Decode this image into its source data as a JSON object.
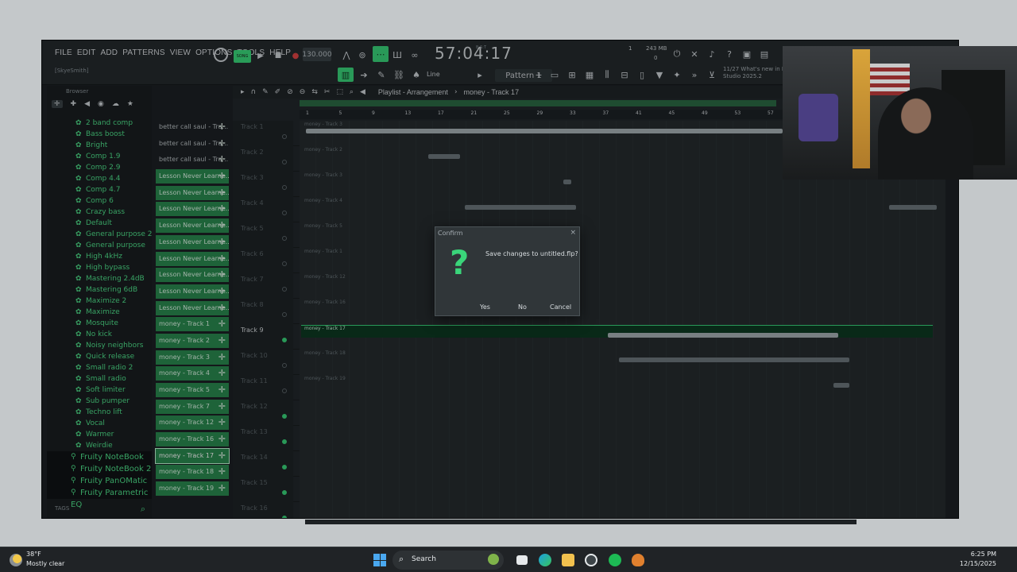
{
  "menu": [
    "FILE",
    "EDIT",
    "ADD",
    "PATTERNS",
    "VIEW",
    "OPTIONS",
    "TOOLS",
    "HELP"
  ],
  "user": "[SkyeSmith]",
  "transport": {
    "song_label": "SONG",
    "tempo": "130.000",
    "time": "57:04:17",
    "time_sub": "B:S:T"
  },
  "memory": {
    "mb": "243 MB",
    "zero": "0",
    "one": "1"
  },
  "pattern": {
    "label": "Pattern 1"
  },
  "line_mode": "Line",
  "news": "11/27  What's new in FL Studio 2025.2",
  "browser": {
    "title": "Browser",
    "presets": [
      "2 band comp",
      "Bass boost",
      "Bright",
      "Comp 1.9",
      "Comp 2.9",
      "Comp 4.4",
      "Comp 4.7",
      "Comp 6",
      "Crazy bass",
      "Default",
      "General purpose 2",
      "General purpose",
      "High 4kHz",
      "High bypass",
      "Mastering 2.4dB",
      "Mastering 6dB",
      "Maximize 2",
      "Maximize",
      "Mosquite",
      "No kick",
      "Noisy neighbors",
      "Quick release",
      "Small radio 2",
      "Small radio",
      "Soft limiter",
      "Sub pumper",
      "Techno lift",
      "Vocal",
      "Warmer",
      "Weirdie"
    ],
    "plugins": [
      "Fruity NoteBook",
      "Fruity NoteBook 2",
      "Fruity PanOMatic",
      "Fruity Parametric EQ"
    ],
    "tags": "TAGS"
  },
  "clips": [
    {
      "label": "better call saul - Tra...",
      "style": "dark"
    },
    {
      "label": "better call saul - Tra...",
      "style": "dark"
    },
    {
      "label": "better call saul - Tra...",
      "style": "dark"
    },
    {
      "label": "Lesson Never Learne...",
      "style": "green"
    },
    {
      "label": "Lesson Never Learne...",
      "style": "green"
    },
    {
      "label": "Lesson Never Learne...",
      "style": "green"
    },
    {
      "label": "Lesson Never Learne...",
      "style": "green"
    },
    {
      "label": "Lesson Never Learne...",
      "style": "green"
    },
    {
      "label": "Lesson Never Learne...",
      "style": "green"
    },
    {
      "label": "Lesson Never Learne...",
      "style": "green"
    },
    {
      "label": "Lesson Never Learne...",
      "style": "green"
    },
    {
      "label": "Lesson Never Learne...",
      "style": "green"
    },
    {
      "label": "money - Track 1",
      "style": "green"
    },
    {
      "label": "money - Track 2",
      "style": "green"
    },
    {
      "label": "money - Track 3",
      "style": "green"
    },
    {
      "label": "money - Track 4",
      "style": "green"
    },
    {
      "label": "money - Track 5",
      "style": "green"
    },
    {
      "label": "money - Track 7",
      "style": "green"
    },
    {
      "label": "money - Track 12",
      "style": "green"
    },
    {
      "label": "money - Track 16",
      "style": "green"
    },
    {
      "label": "money - Track 17",
      "style": "sel"
    },
    {
      "label": "money - Track 18",
      "style": "green"
    },
    {
      "label": "money - Track 19",
      "style": "green"
    }
  ],
  "playlist": {
    "title": "Playlist - Arrangement",
    "selected_clip": "money - Track 17",
    "ruler_ticks": [
      "1",
      "5",
      "9",
      "13",
      "17",
      "21",
      "25",
      "29",
      "33",
      "37",
      "41",
      "45",
      "49",
      "53",
      "57"
    ],
    "tracks": [
      {
        "name": "Track 1",
        "clip": "money - Track 3",
        "active": false
      },
      {
        "name": "Track 2",
        "clip": "money - Track 2",
        "active": false
      },
      {
        "name": "Track 3",
        "clip": "money - Track 3",
        "active": false
      },
      {
        "name": "Track 4",
        "clip": "money - Track 4",
        "active": false
      },
      {
        "name": "Track 5",
        "clip": "money - Track 5",
        "active": false
      },
      {
        "name": "Track 6",
        "clip": "money - Track 1",
        "active": false
      },
      {
        "name": "Track 7",
        "clip": "money - Track 12",
        "active": false
      },
      {
        "name": "Track 8",
        "clip": "money - Track 16",
        "active": false
      },
      {
        "name": "Track 9",
        "clip": "money - Track 17",
        "active": true
      },
      {
        "name": "Track 10",
        "clip": "money - Track 18",
        "active": false
      },
      {
        "name": "Track 11",
        "clip": "money - Track 19",
        "active": false
      },
      {
        "name": "Track 12",
        "clip": "",
        "active": false
      },
      {
        "name": "Track 13",
        "clip": "",
        "active": false
      },
      {
        "name": "Track 14",
        "clip": "",
        "active": false
      },
      {
        "name": "Track 15",
        "clip": "",
        "active": false
      },
      {
        "name": "Track 16",
        "clip": "",
        "active": false
      }
    ]
  },
  "dialog": {
    "title": "Confirm",
    "message": "Save changes to untitled.flp?",
    "yes": "Yes",
    "no": "No",
    "cancel": "Cancel"
  },
  "taskbar": {
    "temp": "38°F",
    "weather": "Mostly clear",
    "search": "Search",
    "time": "6:25 PM",
    "date": "12/15/2025"
  },
  "colors": {
    "accent": "#3ad57a",
    "clip_green": "#2a8a50",
    "bg": "#1d2124"
  }
}
